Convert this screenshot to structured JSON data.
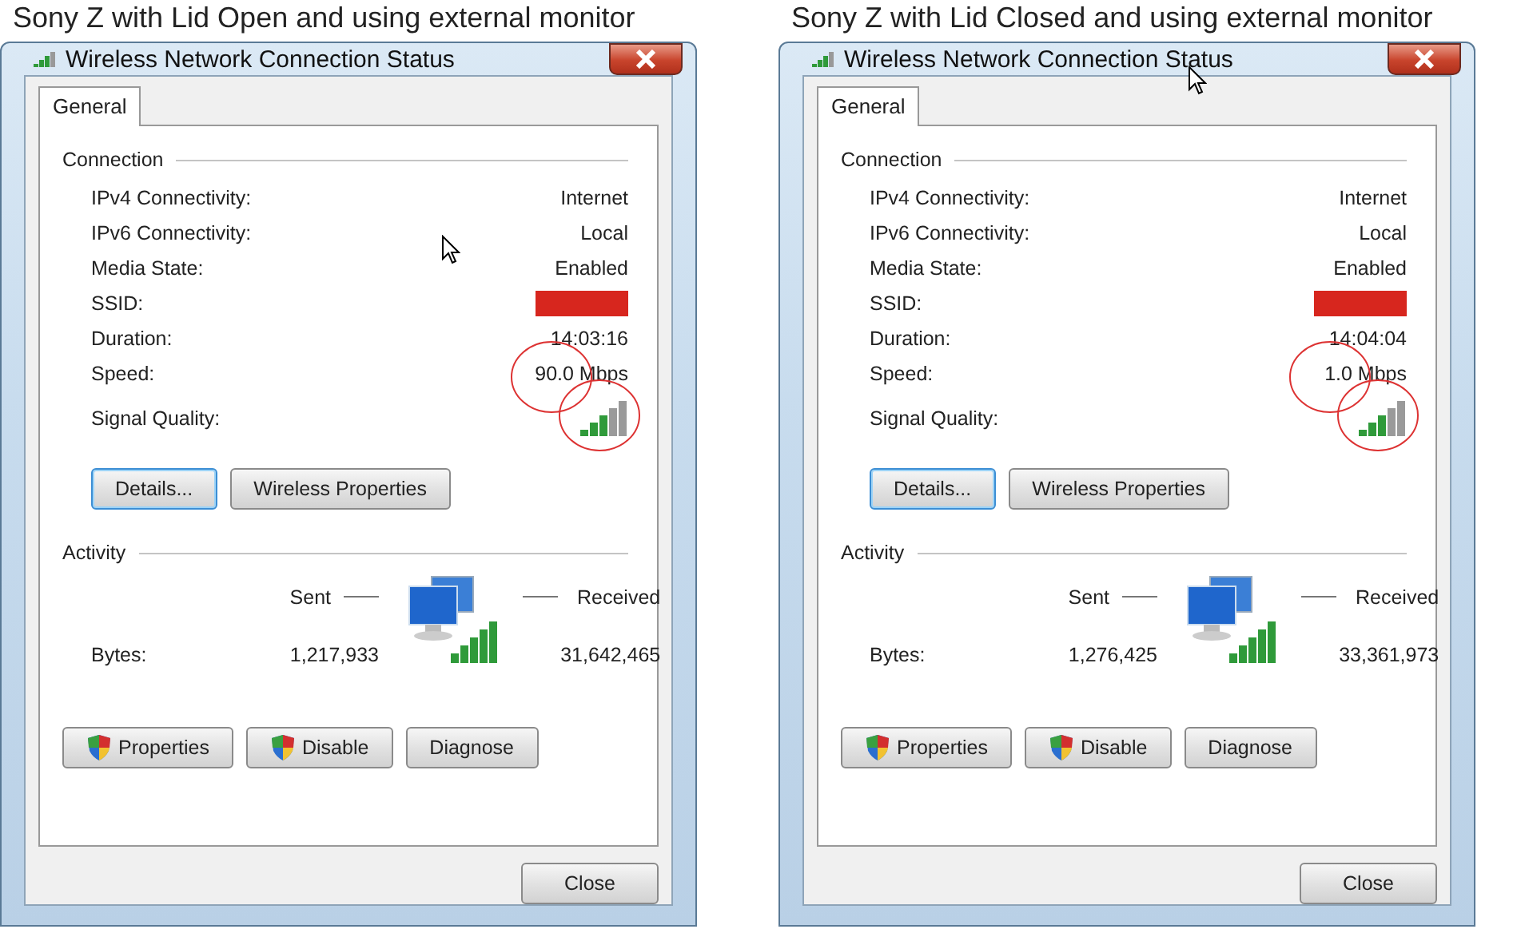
{
  "panels": [
    {
      "caption": "Sony Z with Lid Open and using external monitor",
      "window": {
        "title": "Wireless Network Connection Status",
        "pointer_in_title": false,
        "tabs": [
          {
            "label": "General",
            "selected": true
          }
        ],
        "connection": {
          "heading": "Connection",
          "rows": [
            {
              "kind": "text",
              "label": "IPv4 Connectivity:",
              "value": "Internet",
              "circled": false
            },
            {
              "kind": "text",
              "label": "IPv6 Connectivity:",
              "value": "Local",
              "circled": false
            },
            {
              "kind": "text",
              "label": "Media State:",
              "value": "Enabled",
              "circled": false
            },
            {
              "kind": "redacted",
              "label": "SSID:",
              "circled": false
            },
            {
              "kind": "text",
              "label": "Duration:",
              "value": "14:03:16",
              "circled": false
            },
            {
              "kind": "text",
              "label": "Speed:",
              "value": "90.0 Mbps",
              "circled": true
            },
            {
              "kind": "signal",
              "label": "Signal Quality:",
              "circled": true
            }
          ],
          "buttons": [
            {
              "label": "Details...",
              "focused": true
            },
            {
              "label": "Wireless Properties",
              "focused": false
            }
          ]
        },
        "activity": {
          "heading": "Activity",
          "sent_label": "Sent",
          "received_label": "Received",
          "bytes_label": "Bytes:",
          "sent": "1,217,933",
          "received": "31,642,465"
        },
        "actions": [
          {
            "label": "Properties",
            "shield": true
          },
          {
            "label": "Disable",
            "shield": true
          },
          {
            "label": "Diagnose",
            "shield": false
          }
        ],
        "close": "Close"
      }
    },
    {
      "caption": "Sony Z with Lid Closed and using external monitor",
      "window": {
        "title": "Wireless Network Connection Status",
        "pointer_in_title": true,
        "tabs": [
          {
            "label": "General",
            "selected": true
          }
        ],
        "connection": {
          "heading": "Connection",
          "rows": [
            {
              "kind": "text",
              "label": "IPv4 Connectivity:",
              "value": "Internet",
              "circled": false
            },
            {
              "kind": "text",
              "label": "IPv6 Connectivity:",
              "value": "Local",
              "circled": false
            },
            {
              "kind": "text",
              "label": "Media State:",
              "value": "Enabled",
              "circled": false
            },
            {
              "kind": "redacted",
              "label": "SSID:",
              "circled": false
            },
            {
              "kind": "text",
              "label": "Duration:",
              "value": "14:04:04",
              "circled": false
            },
            {
              "kind": "text",
              "label": "Speed:",
              "value": "1.0 Mbps",
              "circled": true
            },
            {
              "kind": "signal",
              "label": "Signal Quality:",
              "circled": true
            }
          ],
          "buttons": [
            {
              "label": "Details...",
              "focused": true
            },
            {
              "label": "Wireless Properties",
              "focused": false
            }
          ]
        },
        "activity": {
          "heading": "Activity",
          "sent_label": "Sent",
          "received_label": "Received",
          "bytes_label": "Bytes:",
          "sent": "1,276,425",
          "received": "33,361,973"
        },
        "actions": [
          {
            "label": "Properties",
            "shield": true
          },
          {
            "label": "Disable",
            "shield": true
          },
          {
            "label": "Diagnose",
            "shield": false
          }
        ],
        "close": "Close"
      }
    }
  ]
}
